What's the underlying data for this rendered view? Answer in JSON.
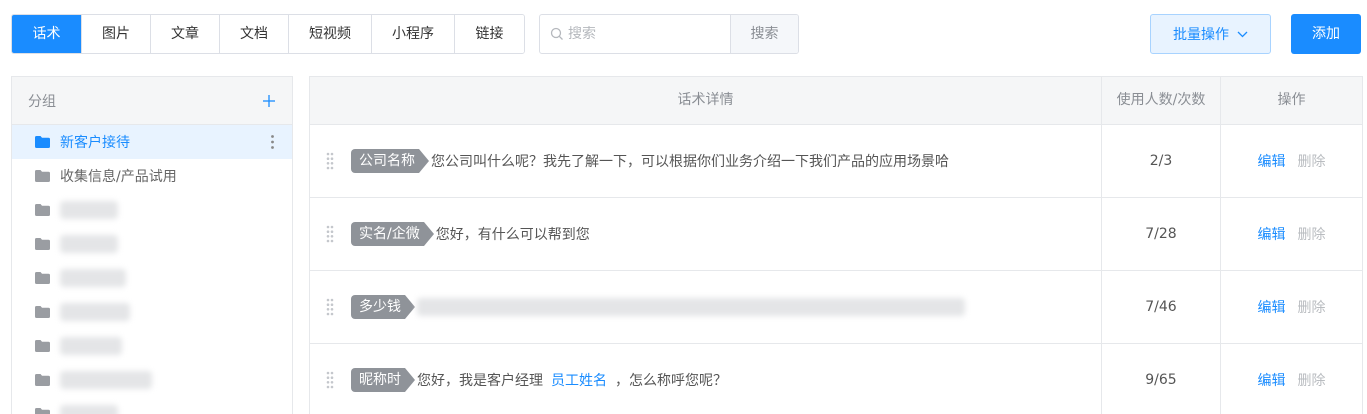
{
  "tabs": [
    {
      "label": "话术",
      "active": true
    },
    {
      "label": "图片",
      "active": false
    },
    {
      "label": "文章",
      "active": false
    },
    {
      "label": "文档",
      "active": false
    },
    {
      "label": "短视频",
      "active": false
    },
    {
      "label": "小程序",
      "active": false
    },
    {
      "label": "链接",
      "active": false
    }
  ],
  "search": {
    "placeholder": "搜索",
    "button_label": "搜索"
  },
  "toolbar": {
    "batch_label": "批量操作",
    "add_label": "添加"
  },
  "sidebar": {
    "title": "分组",
    "items": [
      {
        "label": "新客户接待",
        "active": true
      },
      {
        "label": "收集信息/产品试用",
        "active": false
      }
    ]
  },
  "table": {
    "headers": {
      "detail": "话术详情",
      "usage": "使用人数/次数",
      "ops": "操作"
    },
    "edit_label": "编辑",
    "delete_label": "删除",
    "rows": [
      {
        "tag": "公司名称",
        "text": "您公司叫什么呢？我先了解一下，可以根据你们业务介绍一下我们产品的应用场景哈",
        "usage": "2/3"
      },
      {
        "tag": "实名/企微",
        "text": "您好，有什么可以帮到您",
        "usage": "7/28"
      },
      {
        "tag": "多少钱",
        "usage": "7/46"
      },
      {
        "tag": "昵称时",
        "text_before": "您好，我是客户经理",
        "variable": "员工姓名",
        "text_after": "，怎么称呼您呢？",
        "usage": "9/65"
      }
    ]
  },
  "colors": {
    "primary": "#1a8cff",
    "tag_bg": "#8f9399",
    "header_bg": "#f5f6f7"
  }
}
